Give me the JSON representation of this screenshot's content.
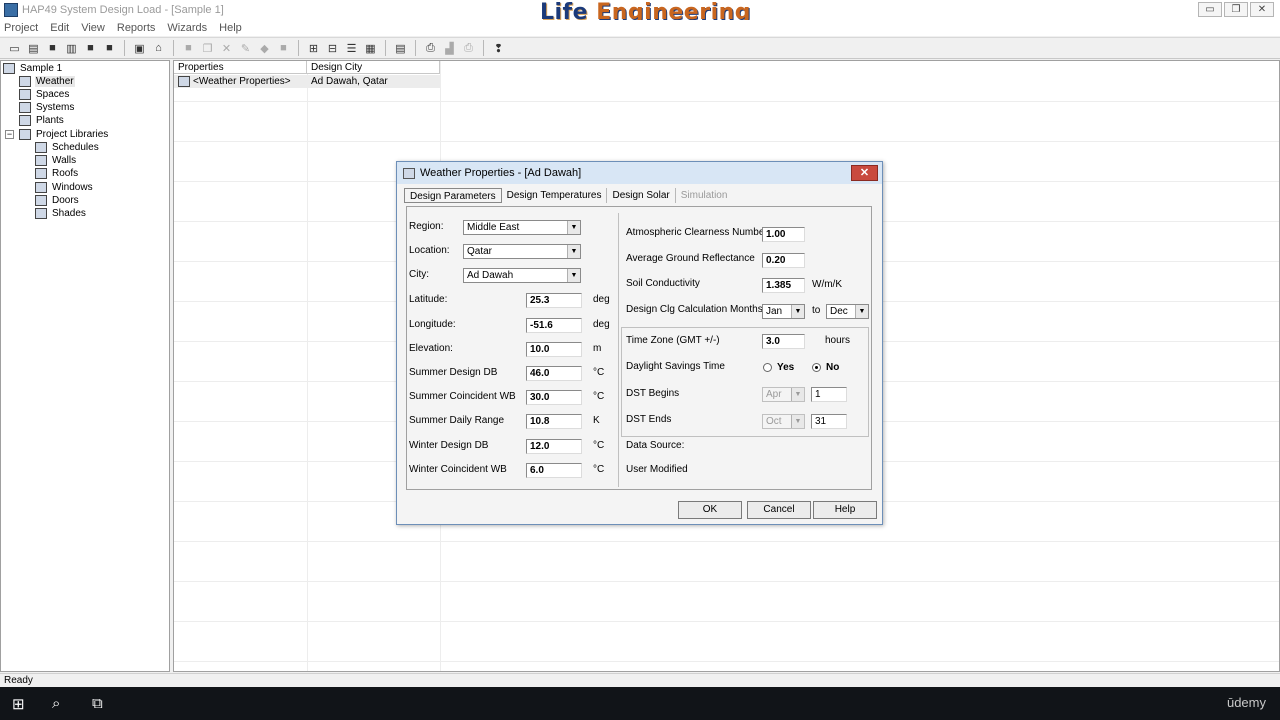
{
  "window": {
    "title": "HAP49 System Design Load - [Sample 1]",
    "brand_word1": "Life",
    "brand_word2": "Engineering",
    "min_label": "▭",
    "max_label": "❐",
    "close_label": "✕"
  },
  "menu": [
    "Project",
    "Edit",
    "View",
    "Reports",
    "Wizards",
    "Help"
  ],
  "tree": {
    "root": "Sample 1",
    "items": [
      {
        "label": "Weather",
        "icon": "weather-icon"
      },
      {
        "label": "Spaces",
        "icon": "spaces-icon"
      },
      {
        "label": "Systems",
        "icon": "systems-icon"
      },
      {
        "label": "Plants",
        "icon": "plants-icon"
      },
      {
        "label": "Project Libraries",
        "icon": "project-libraries-icon"
      },
      {
        "label": "Schedules",
        "icon": "schedules-icon"
      },
      {
        "label": "Walls",
        "icon": "walls-icon"
      },
      {
        "label": "Roofs",
        "icon": "roofs-icon"
      },
      {
        "label": "Windows",
        "icon": "windows-icon"
      },
      {
        "label": "Doors",
        "icon": "doors-icon"
      },
      {
        "label": "Shades",
        "icon": "shades-icon"
      }
    ]
  },
  "list": {
    "headers": [
      "Properties",
      "Design City"
    ],
    "row": {
      "property": "<Weather Properties>",
      "city": "Ad Dawah, Qatar"
    }
  },
  "status": "Ready",
  "taskbar": {
    "udemy": "ūdemy"
  },
  "dialog": {
    "title": "Weather Properties - [Ad Dawah]",
    "tabs": [
      "Design Parameters",
      "Design Temperatures",
      "Design Solar",
      "Simulation"
    ],
    "left": {
      "region_label": "Region:",
      "region_value": "Middle East",
      "location_label": "Location:",
      "location_value": "Qatar",
      "city_label": "City:",
      "city_value": "Ad Dawah",
      "latitude_label": "Latitude:",
      "latitude_value": "25.3",
      "latitude_unit": "deg",
      "longitude_label": "Longitude:",
      "longitude_value": "-51.6",
      "longitude_unit": "deg",
      "elevation_label": "Elevation:",
      "elevation_value": "10.0",
      "elevation_unit": "m",
      "sdb_label": "Summer Design DB",
      "sdb_value": "46.0",
      "sdb_unit": "°C",
      "swb_label": "Summer Coincident WB",
      "swb_value": "30.0",
      "swb_unit": "°C",
      "sdr_label": "Summer Daily Range",
      "sdr_value": "10.8",
      "sdr_unit": "K",
      "wdb_label": "Winter Design DB",
      "wdb_value": "12.0",
      "wdb_unit": "°C",
      "wwb_label": "Winter Coincident WB",
      "wwb_value": "6.0",
      "wwb_unit": "°C"
    },
    "right": {
      "acn_label": "Atmospheric Clearness Number",
      "acn_value": "1.00",
      "agr_label": "Average Ground Reflectance",
      "agr_value": "0.20",
      "soil_label": "Soil Conductivity",
      "soil_value": "1.385",
      "soil_unit": "W/m/K",
      "months_label": "Design Clg Calculation Months",
      "months_from": "Jan",
      "months_to_label": "to",
      "months_to": "Dec",
      "tz_label": "Time Zone (GMT +/-)",
      "tz_value": "3.0",
      "tz_unit": "hours",
      "dst_label": "Daylight Savings Time",
      "dst_yes": "Yes",
      "dst_no": "No",
      "dst_begins_label": "DST Begins",
      "dst_begins_month": "Apr",
      "dst_begins_day": "1",
      "dst_ends_label": "DST Ends",
      "dst_ends_month": "Oct",
      "dst_ends_day": "31",
      "data_source_label": "Data Source:",
      "data_source_value": "User Modified"
    },
    "buttons": {
      "ok": "OK",
      "cancel": "Cancel",
      "help": "Help"
    }
  }
}
